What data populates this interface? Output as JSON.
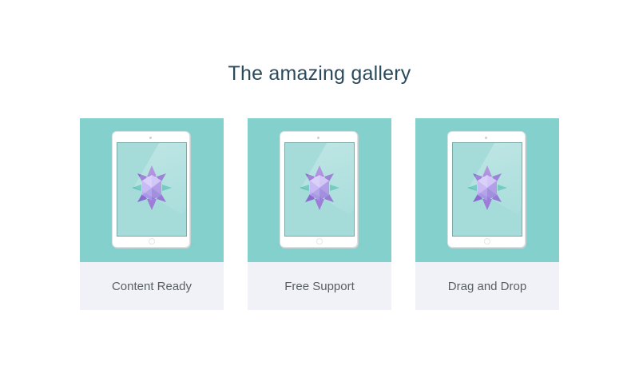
{
  "gallery": {
    "title": "The amazing gallery"
  },
  "cards": [
    {
      "caption": "Content Ready",
      "image_icon": "tablet-gem-icon"
    },
    {
      "caption": "Free Support",
      "image_icon": "tablet-gem-icon"
    },
    {
      "caption": "Drag and Drop",
      "image_icon": "tablet-gem-icon"
    }
  ],
  "colors": {
    "card_image_bg": "#84d0cd",
    "caption_bg": "#f1f2f7",
    "title_text": "#2b4a5c",
    "caption_text": "#595f66",
    "gem_purple": "#9b7ad6",
    "gem_teal": "#5fc3b8"
  }
}
